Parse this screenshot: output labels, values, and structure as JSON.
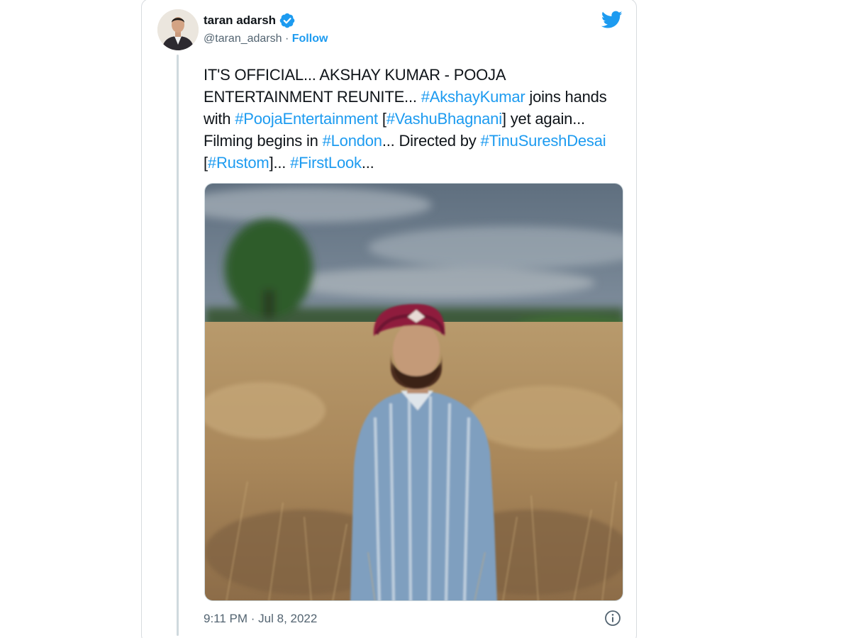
{
  "author": {
    "display_name": "taran adarsh",
    "handle": "@taran_adarsh",
    "separator": " · ",
    "follow_label": "Follow",
    "avatar_icon": "profile-photo",
    "verified_icon": "verified-badge-icon"
  },
  "tweet": {
    "segments": [
      {
        "text": "IT'S OFFICIAL... AKSHAY KUMAR - POOJA ENTERTAINMENT REUNITE... ",
        "tag": false
      },
      {
        "text": "#AkshayKumar",
        "tag": true
      },
      {
        "text": " joins hands with ",
        "tag": false
      },
      {
        "text": "#PoojaEntertainment",
        "tag": true
      },
      {
        "text": " [",
        "tag": false
      },
      {
        "text": "#VashuBhagnani",
        "tag": true
      },
      {
        "text": "] yet again... Filming begins in ",
        "tag": false
      },
      {
        "text": "#London",
        "tag": true
      },
      {
        "text": "... Directed by ",
        "tag": false
      },
      {
        "text": "#TinuSureshDesai",
        "tag": true
      },
      {
        "text": " [",
        "tag": false
      },
      {
        "text": "#Rustom",
        "tag": true
      },
      {
        "text": "]... ",
        "tag": false
      },
      {
        "text": "#FirstLook",
        "tag": true
      },
      {
        "text": "...",
        "tag": false
      }
    ],
    "timestamp": "9:11 PM · Jul 8, 2022"
  },
  "icons": {
    "brand": "twitter-bird-icon",
    "info": "info-icon"
  },
  "colors": {
    "link": "#1d9bf0",
    "text": "#0f1419",
    "secondary": "#536471",
    "border": "#cfd9de"
  }
}
